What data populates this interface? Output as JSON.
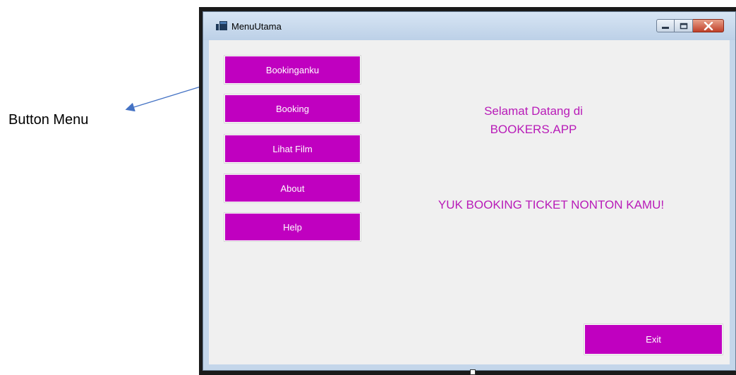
{
  "annotation": {
    "label": "Button Menu"
  },
  "window": {
    "title": "MenuUtama"
  },
  "menu": {
    "items": [
      {
        "label": "Bookinganku"
      },
      {
        "label": "Booking"
      },
      {
        "label": "Lihat Film"
      },
      {
        "label": "About"
      },
      {
        "label": "Help"
      }
    ]
  },
  "content": {
    "welcome_line1": "Selamat Datang di",
    "welcome_line2": "BOOKERS.APP",
    "tagline": "YUK BOOKING TICKET NONTON KAMU!"
  },
  "footer": {
    "exit_label": "Exit"
  },
  "colors": {
    "button_bg": "#c000c0",
    "text_accent": "#b81bb8"
  },
  "icons": {
    "app": "form-window-icon",
    "minimize": "minimize-icon",
    "maximize": "maximize-icon",
    "close": "close-icon"
  }
}
